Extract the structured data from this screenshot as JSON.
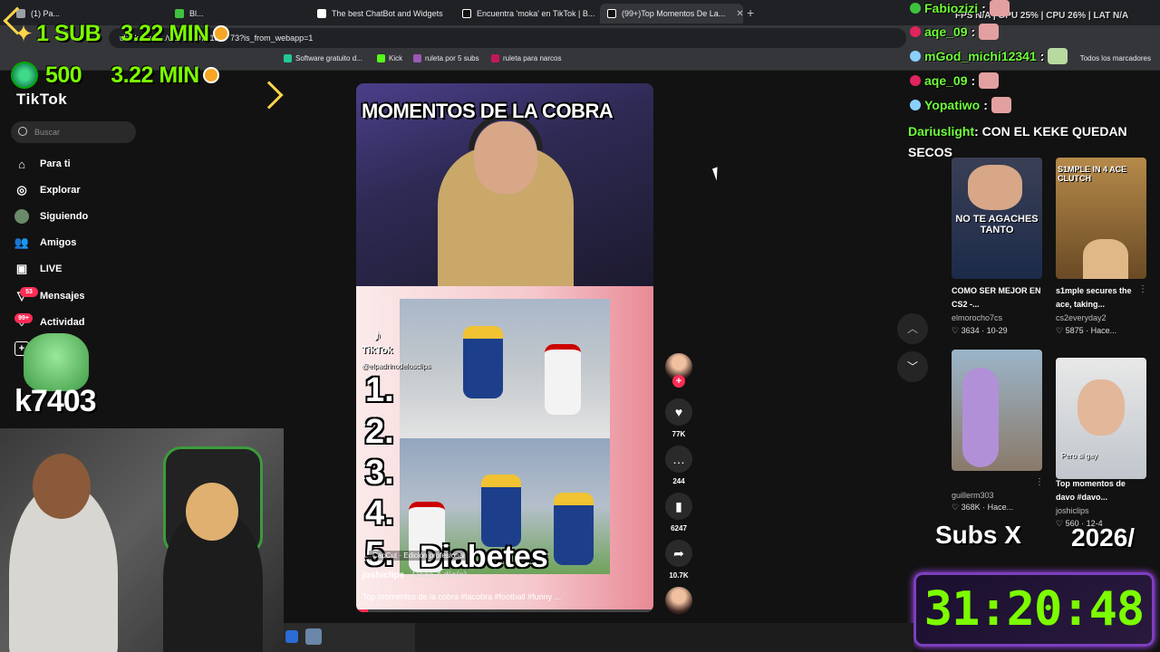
{
  "browser": {
    "tabs": [
      {
        "label": "(1) Pa...",
        "active": false
      },
      {
        "label": "Bl...",
        "active": false
      },
      {
        "label": "The best ChatBot and Widgets",
        "active": false
      },
      {
        "label": "Encuentra 'moka' en TikTok | B...",
        "active": false
      },
      {
        "label": "(99+)Top Momentos De La...",
        "active": true
      }
    ],
    "url": "tiktok.com/.../video/...0701867 73?is_from_webapp=1",
    "bookmarks": [
      {
        "label": "Software gratuito d...",
        "color": "#20c997"
      },
      {
        "label": "Kick",
        "color": "#53fc18"
      },
      {
        "label": "ruleta por 5 subs",
        "color": "#9b59b6"
      },
      {
        "label": "ruleta para narcos",
        "color": "#c2185b"
      }
    ],
    "bookmarks_right": "Todos los marcadores"
  },
  "tiktok": {
    "brand": "TikTok",
    "search_placeholder": "Buscar",
    "nav": [
      {
        "label": "Para ti",
        "icon": "home-icon"
      },
      {
        "label": "Explorar",
        "icon": "compass-icon"
      },
      {
        "label": "Siguiendo",
        "icon": "following-avatar-icon"
      },
      {
        "label": "Amigos",
        "icon": "friends-icon"
      },
      {
        "label": "LIVE",
        "icon": "live-icon"
      },
      {
        "label": "Mensajes",
        "icon": "messages-icon",
        "badge": "53"
      },
      {
        "label": "Actividad",
        "icon": "activity-icon",
        "badge": "99+"
      }
    ]
  },
  "overlay": {
    "sub_line_1": {
      "count": "1 SUB",
      "time": "3.22 MIN"
    },
    "sub_line_2": {
      "count": "500",
      "time": "3.22 MIN"
    },
    "username_big": "k7403",
    "subs_label": "Subs X",
    "subs_label_2": "2026/",
    "timer": "31:20:48"
  },
  "stream_stats": "FPS N/A | GPU 25% | CPU 26% | LAT N/A",
  "chat": [
    {
      "user": "Fabiozizi",
      "text": ":",
      "badge_color": "#3ec23e"
    },
    {
      "user": "aqe_09",
      "text": ":",
      "badge_color": "#e0245e"
    },
    {
      "user": "mGod_michi12341",
      "text": ":",
      "badge_color": "#8ad0ff"
    },
    {
      "user": "aqe_09",
      "text": ":",
      "badge_color": "#e0245e"
    },
    {
      "user": "Yopatiwo",
      "text": ":",
      "badge_color": "#8ad0ff"
    }
  ],
  "chat_wrap": {
    "user": "Dariuslight",
    "text": ": CON EL KEKE QUEDAN SECOS"
  },
  "video": {
    "title_overlay": "MOMENTOS DE LA COBRA",
    "watermark": "TikTok",
    "watermark_handle": "@elpadrinodelosclips",
    "ranks": [
      "1.",
      "2.",
      "3.",
      "4.",
      "5."
    ],
    "rank5_text": "Diabetes",
    "capcut": "CapCut · Edición profesional",
    "author": "joshiclips",
    "ago": " · Hace 4 día(s)",
    "description": "Top momentos de la cobra #lacobra #football #funny ...",
    "progress": 0.04,
    "likes": "77K",
    "comments": "244",
    "saves": "6247",
    "shares": "10.7K"
  },
  "suggestions": [
    {
      "caption": "COMO SER MEJOR EN CS2 -...",
      "user": "elmorocho7cs",
      "likes": "3634",
      "date": "10-29",
      "overlay": "NO TE AGACHES TANTO"
    },
    {
      "caption": "s1mple secures the ace, taking...",
      "user": "cs2everyday2",
      "likes": "5875",
      "date": "Hace...",
      "overlay": "S1MPLE IN 4 ACE CLUTCH"
    },
    {
      "caption": "",
      "user": "guillerm303",
      "likes": "368K",
      "date": "Hace...",
      "overlay": ""
    },
    {
      "caption": "Top momentos de davo #davo...",
      "user": "joshiclips",
      "likes": "560",
      "date": "12-4",
      "overlay": "Pero si gay"
    }
  ]
}
